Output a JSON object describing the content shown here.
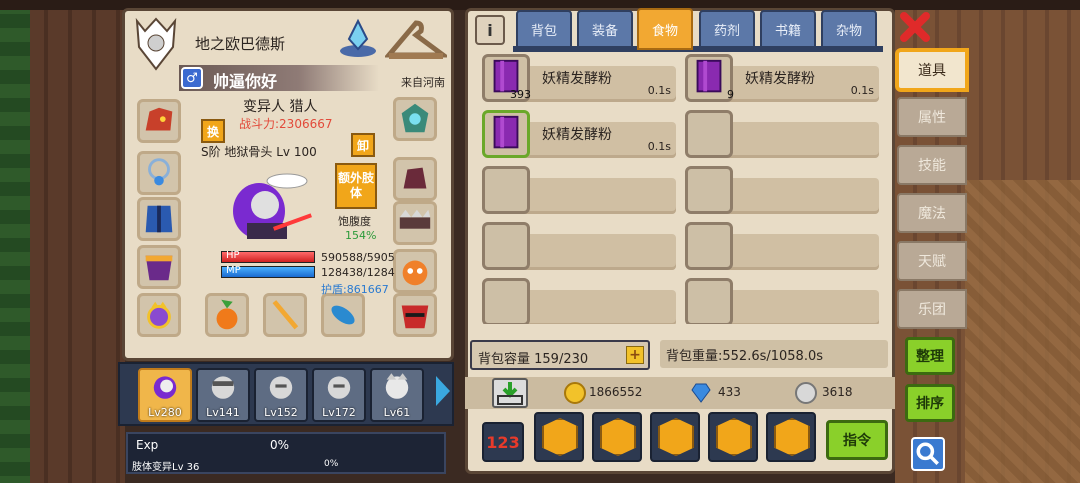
{
  "character": {
    "guild_name": "地之欧巴德斯",
    "player_name": "帅逼你好",
    "location": "来自河南",
    "classes": "变异人 猎人",
    "power": "战斗力:2306667",
    "grade": "S阶 地狱骨头 Lv 100",
    "swap_label": "换",
    "unequip_label": "卸",
    "extra_limb_label": "额外肢体",
    "satiety_label": "饱腹度",
    "satiety_value": "154%",
    "hp_label": "HP",
    "mp_label": "MP",
    "hp_value": "590588/5905",
    "mp_value": "128438/1284",
    "shield_value": "护盾:861667",
    "hp_fraction": 1.0,
    "mp_fraction": 1.0
  },
  "roster": [
    {
      "level": "Lv280",
      "selected": true
    },
    {
      "level": "Lv141",
      "selected": false
    },
    {
      "level": "Lv152",
      "selected": false
    },
    {
      "level": "Lv172",
      "selected": false
    },
    {
      "level": "Lv61",
      "selected": false
    }
  ],
  "exp": {
    "label": "Exp",
    "percent": "0%",
    "limb_label": "肢体变异Lv 36",
    "limb_percent": "0%"
  },
  "inventory": {
    "info_label": "i",
    "tabs": [
      {
        "label": "背包",
        "active": false
      },
      {
        "label": "装备",
        "active": false
      },
      {
        "label": "食物",
        "active": true
      },
      {
        "label": "药剂",
        "active": false
      },
      {
        "label": "书籍",
        "active": false
      },
      {
        "label": "杂物",
        "active": false
      }
    ],
    "items": [
      {
        "name": "妖精发酵粉",
        "count": "393",
        "time": "0.1s"
      },
      {
        "name": "妖精发酵粉",
        "count": "9",
        "time": "0.1s"
      },
      {
        "name": "妖精发酵粉",
        "count": "",
        "time": "0.1s"
      }
    ],
    "capacity": "背包容量 159/230",
    "capacity_plus": "+",
    "weight": "背包重量:552.6s/1058.0s",
    "currencies": [
      {
        "name": "gold-coin",
        "value": "1866552",
        "color": "#f2c22a"
      },
      {
        "name": "diamond",
        "value": "433",
        "color": "#3a8ae0"
      },
      {
        "name": "silver-coin",
        "value": "3618",
        "color": "#d8d8d8"
      }
    ],
    "sort_number_label": "123",
    "command_label": "指令"
  },
  "side_menu": [
    {
      "label": "道具",
      "active": true
    },
    {
      "label": "属性",
      "active": false
    },
    {
      "label": "技能",
      "active": false
    },
    {
      "label": "魔法",
      "active": false
    },
    {
      "label": "天赋",
      "active": false
    },
    {
      "label": "乐团",
      "active": false
    }
  ],
  "buttons": {
    "organize": "整理",
    "sort": "排序"
  },
  "colors": {
    "accent_orange": "#f1a61a",
    "tab_blue": "#5c78a8",
    "green_button": "#8ad02a",
    "panel_bg": "#e8dcc6"
  }
}
